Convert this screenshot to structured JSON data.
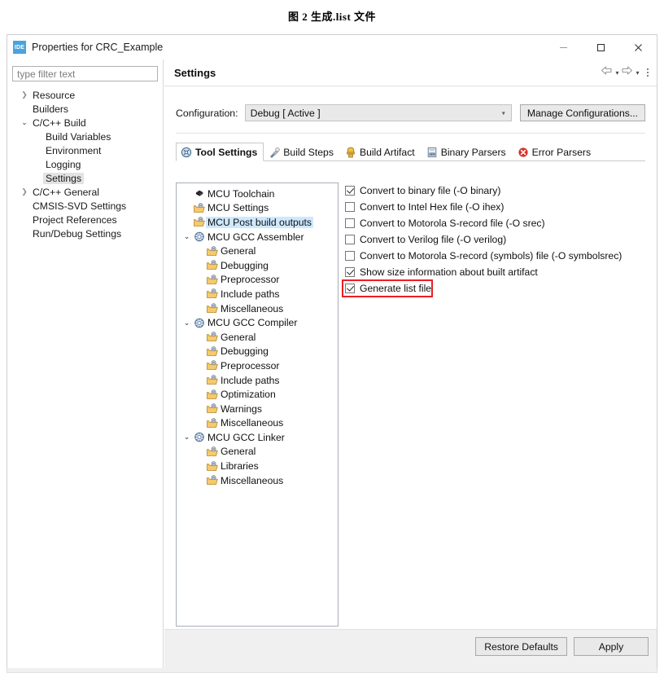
{
  "caption": "图 2 生成.list 文件",
  "window": {
    "icon_label": "IDE",
    "icon_name": "ide-icon",
    "title": "Properties for CRC_Example",
    "controls": {
      "minimize": "—",
      "maximize": "☐",
      "close": "✕"
    }
  },
  "filter": {
    "placeholder": "type filter text",
    "value": ""
  },
  "sidebar": {
    "items": [
      {
        "label": "Resource",
        "indent": 0,
        "arrow": "collapsed",
        "selected": false
      },
      {
        "label": "Builders",
        "indent": 0,
        "arrow": "none",
        "selected": false
      },
      {
        "label": "C/C++ Build",
        "indent": 0,
        "arrow": "expanded",
        "selected": false
      },
      {
        "label": "Build Variables",
        "indent": 1,
        "arrow": "none",
        "selected": false
      },
      {
        "label": "Environment",
        "indent": 1,
        "arrow": "none",
        "selected": false
      },
      {
        "label": "Logging",
        "indent": 1,
        "arrow": "none",
        "selected": false
      },
      {
        "label": "Settings",
        "indent": 1,
        "arrow": "none",
        "selected": true
      },
      {
        "label": "C/C++ General",
        "indent": 0,
        "arrow": "collapsed",
        "selected": false
      },
      {
        "label": "CMSIS-SVD Settings",
        "indent": 0,
        "arrow": "none",
        "selected": false
      },
      {
        "label": "Project References",
        "indent": 0,
        "arrow": "none",
        "selected": false
      },
      {
        "label": "Run/Debug Settings",
        "indent": 0,
        "arrow": "none",
        "selected": false
      }
    ]
  },
  "settings_header": {
    "title": "Settings",
    "back_icon": "back-arrow-icon",
    "forward_icon": "forward-arrow-icon",
    "menu_icon": "view-menu-icon"
  },
  "configuration": {
    "label": "Configuration:",
    "value": "Debug  [ Active ]",
    "manage_button": "Manage Configurations..."
  },
  "tabs": [
    {
      "label": "Tool Settings",
      "icon": "tool-settings-icon",
      "active": true
    },
    {
      "label": "Build Steps",
      "icon": "build-steps-icon",
      "active": false
    },
    {
      "label": "Build Artifact",
      "icon": "build-artifact-icon",
      "active": false
    },
    {
      "label": "Binary Parsers",
      "icon": "binary-parsers-icon",
      "active": false
    },
    {
      "label": "Error Parsers",
      "icon": "error-parsers-icon",
      "active": false
    }
  ],
  "tool_tree": [
    {
      "label": "MCU Toolchain",
      "indent": 0,
      "arrow": "none",
      "icon": "toolchain-icon",
      "selected": false
    },
    {
      "label": "MCU Settings",
      "indent": 0,
      "arrow": "none",
      "icon": "folder-icon",
      "selected": false
    },
    {
      "label": "MCU Post build outputs",
      "indent": 0,
      "arrow": "none",
      "icon": "folder-icon",
      "selected": true
    },
    {
      "label": "MCU GCC Assembler",
      "indent": 0,
      "arrow": "expanded",
      "icon": "gear-tool-icon",
      "selected": false
    },
    {
      "label": "General",
      "indent": 1,
      "arrow": "none",
      "icon": "folder-icon",
      "selected": false
    },
    {
      "label": "Debugging",
      "indent": 1,
      "arrow": "none",
      "icon": "folder-icon",
      "selected": false
    },
    {
      "label": "Preprocessor",
      "indent": 1,
      "arrow": "none",
      "icon": "folder-icon",
      "selected": false
    },
    {
      "label": "Include paths",
      "indent": 1,
      "arrow": "none",
      "icon": "folder-icon",
      "selected": false
    },
    {
      "label": "Miscellaneous",
      "indent": 1,
      "arrow": "none",
      "icon": "folder-icon",
      "selected": false
    },
    {
      "label": "MCU GCC Compiler",
      "indent": 0,
      "arrow": "expanded",
      "icon": "gear-tool-icon",
      "selected": false
    },
    {
      "label": "General",
      "indent": 1,
      "arrow": "none",
      "icon": "folder-icon",
      "selected": false
    },
    {
      "label": "Debugging",
      "indent": 1,
      "arrow": "none",
      "icon": "folder-icon",
      "selected": false
    },
    {
      "label": "Preprocessor",
      "indent": 1,
      "arrow": "none",
      "icon": "folder-icon",
      "selected": false
    },
    {
      "label": "Include paths",
      "indent": 1,
      "arrow": "none",
      "icon": "folder-icon",
      "selected": false
    },
    {
      "label": "Optimization",
      "indent": 1,
      "arrow": "none",
      "icon": "folder-icon",
      "selected": false
    },
    {
      "label": "Warnings",
      "indent": 1,
      "arrow": "none",
      "icon": "folder-icon",
      "selected": false
    },
    {
      "label": "Miscellaneous",
      "indent": 1,
      "arrow": "none",
      "icon": "folder-icon",
      "selected": false
    },
    {
      "label": "MCU GCC Linker",
      "indent": 0,
      "arrow": "expanded",
      "icon": "gear-tool-icon",
      "selected": false
    },
    {
      "label": "General",
      "indent": 1,
      "arrow": "none",
      "icon": "folder-icon",
      "selected": false
    },
    {
      "label": "Libraries",
      "indent": 1,
      "arrow": "none",
      "icon": "folder-icon",
      "selected": false
    },
    {
      "label": "Miscellaneous",
      "indent": 1,
      "arrow": "none",
      "icon": "folder-icon",
      "selected": false
    }
  ],
  "options": [
    {
      "label": "Convert to binary file (-O binary)",
      "checked": true,
      "highlighted": false
    },
    {
      "label": "Convert to Intel Hex file (-O ihex)",
      "checked": false,
      "highlighted": false
    },
    {
      "label": "Convert to Motorola S-record file (-O srec)",
      "checked": false,
      "highlighted": false
    },
    {
      "label": "Convert to Verilog file (-O verilog)",
      "checked": false,
      "highlighted": false
    },
    {
      "label": "Convert to Motorola S-record (symbols) file (-O symbolsrec)",
      "checked": false,
      "highlighted": false
    },
    {
      "label": "Show size information about built artifact",
      "checked": true,
      "highlighted": false
    },
    {
      "label": "Generate list file",
      "checked": true,
      "highlighted": true
    }
  ],
  "footer": {
    "restore_defaults": "Restore Defaults",
    "apply": "Apply"
  },
  "colors": {
    "selection_blue": "#cde8ff",
    "highlight_red": "#ee1c25",
    "sidebar_selection": "#e3e3e3",
    "chrome_gray": "#f0f0f0"
  }
}
